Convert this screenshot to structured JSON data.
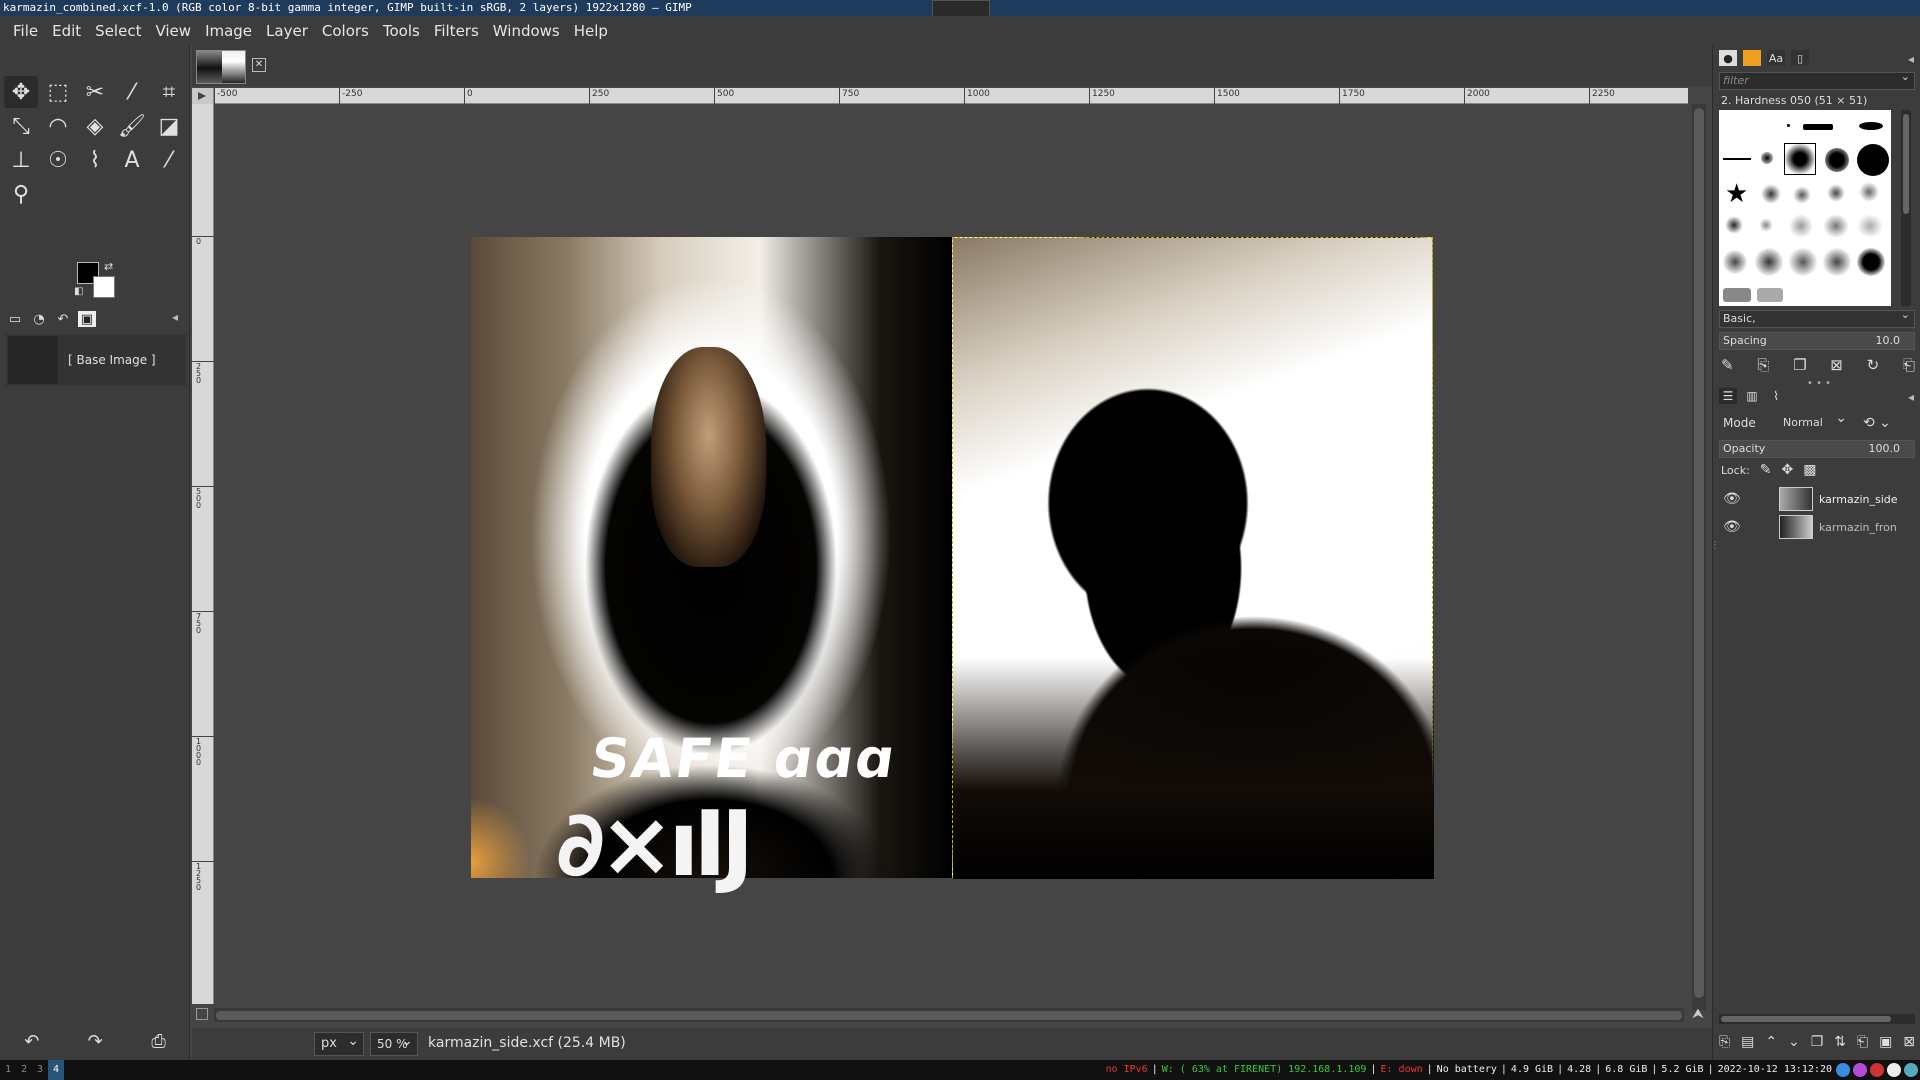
{
  "window": {
    "title": "karmazin_combined.xcf-1.0 (RGB color 8-bit gamma integer, GIMP built-in sRGB, 2 layers) 1922x1280 – GIMP"
  },
  "menu": [
    "File",
    "Edit",
    "Select",
    "View",
    "Image",
    "Layer",
    "Colors",
    "Tools",
    "Filters",
    "Windows",
    "Help"
  ],
  "toolbox": {
    "tools": [
      "move-tool-icon",
      "rect-select-icon",
      "scissors-select-icon",
      "fuzzy-select-icon",
      "crop-icon",
      "unified-transform-icon",
      "warp-icon",
      "bucket-fill-icon",
      "paintbrush-icon",
      "eraser-icon",
      "clone-icon",
      "smudge-icon",
      "paths-icon",
      "text-icon",
      "color-picker-icon",
      "zoom-icon"
    ],
    "fg_color": "#000000",
    "bg_color": "#ffffff"
  },
  "images_panel": {
    "entry_label": "[ Base Image ]"
  },
  "rulers": {
    "h_ticks": [
      "-500",
      "-250",
      "0",
      "250",
      "500",
      "750",
      "1000",
      "1250",
      "1500",
      "1750",
      "2000",
      "2250"
    ],
    "v_ticks": [
      "0",
      "250",
      "500",
      "750",
      "1000",
      "1250"
    ]
  },
  "statusbar": {
    "unit": "px",
    "zoom": "50 %",
    "text": "karmazin_side.xcf (25.4 MB)"
  },
  "brushes": {
    "filter_placeholder": "filter",
    "current_brush": "2. Hardness 050 (51 × 51)",
    "preset": "Basic,",
    "spacing_label": "Spacing",
    "spacing_value": "10.0"
  },
  "layers": {
    "mode_label": "Mode",
    "mode_value": "Normal",
    "opacity_label": "Opacity",
    "opacity_value": "100.0",
    "lock_label": "Lock:",
    "items": [
      {
        "name": "karmazin_side"
      },
      {
        "name": "karmazin_fron"
      }
    ]
  },
  "sysbar": {
    "workspaces": [
      "1",
      "2",
      "3",
      "4"
    ],
    "active_workspace": "4",
    "ipv6": "no IPv6",
    "wifi": "W: ( 63% at FIRENET) 192.168.1.109",
    "eth": "E: down",
    "battery": "No battery",
    "mem_free": "4.9 GiB",
    "load": "4.28",
    "mem_used": "6.8 GiB",
    "disk": "5.2 GiB",
    "datetime": "2022-10-12 13:12:20"
  }
}
